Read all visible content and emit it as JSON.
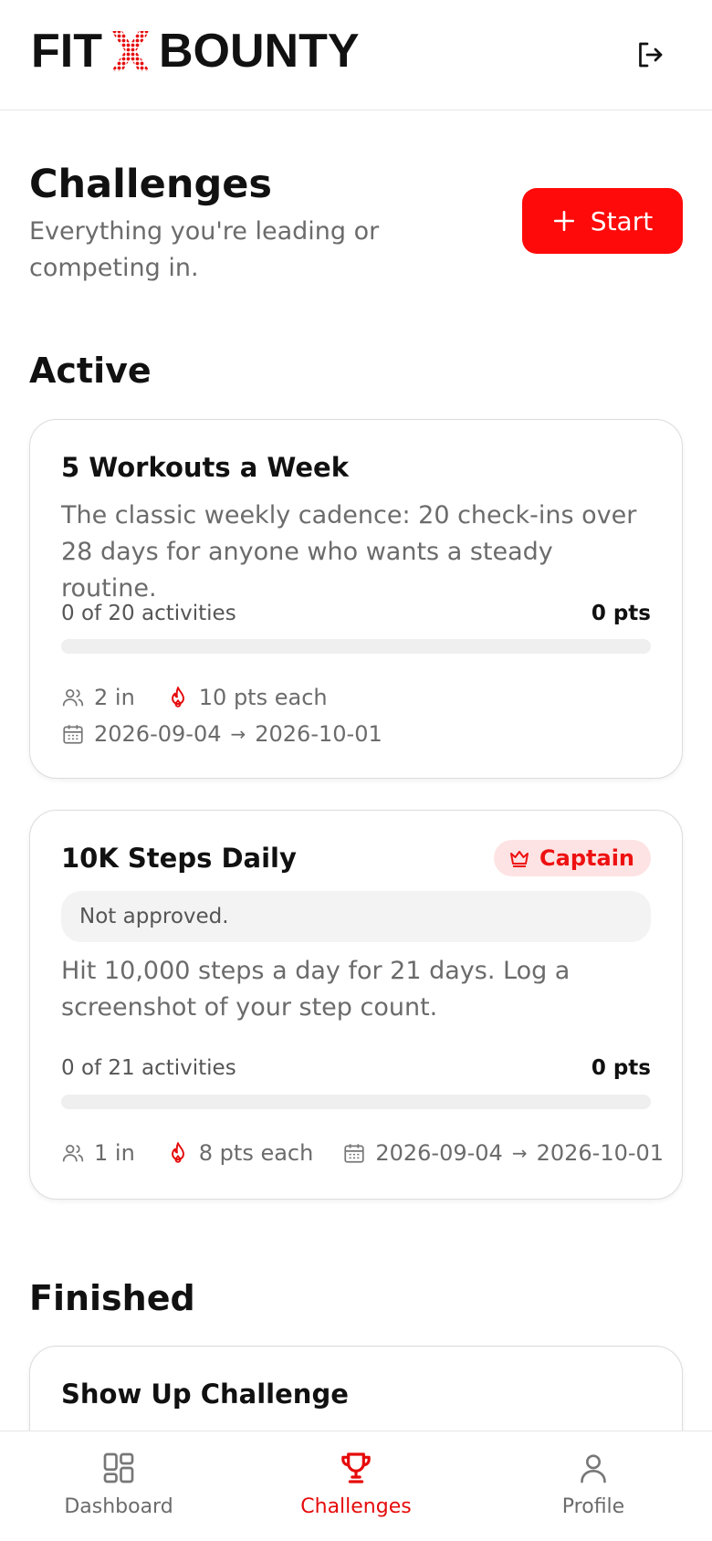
{
  "app": {
    "logo_left": "FIT",
    "logo_right": "BOUNTY"
  },
  "colors": {
    "accent": "#ff0a0a",
    "muted_text": "#6b6b6b",
    "badge_bg": "#fde3e3"
  },
  "header": {
    "logout_icon": "logout-icon"
  },
  "page": {
    "title": "Challenges",
    "subtitle": "Everything you're leading or competing in.",
    "start_label": "Start"
  },
  "sections": {
    "active_title": "Active",
    "finished_title": "Finished"
  },
  "active": [
    {
      "title": "5 Workouts a Week",
      "description": "The classic weekly cadence: 20 check-ins over 28 days for anyone who wants a steady routine.",
      "progress_label": "0 of 20 activities",
      "points": "0 pts",
      "progress": 0,
      "participants": "2 in",
      "pts_each": "10 pts each",
      "start_date": "2026-09-04",
      "arrow": "→",
      "end_date": "2026-10-01"
    },
    {
      "title": "10K Steps Daily",
      "badge": "Captain",
      "notice": "Not approved.",
      "description": "Hit 10,000 steps a day for 21 days. Log a screenshot of your step count.",
      "progress_label": "0 of 21 activities",
      "points": "0 pts",
      "progress": 0,
      "participants": "1 in",
      "pts_each": "8 pts each",
      "start_date": "2026-09-04",
      "arrow": "→",
      "end_date": "2026-10-01"
    }
  ],
  "finished": [
    {
      "title": "Show Up Challenge"
    }
  ],
  "nav": [
    {
      "label": "Dashboard",
      "icon": "dashboard-icon",
      "active": false
    },
    {
      "label": "Challenges",
      "icon": "trophy-icon",
      "active": true
    },
    {
      "label": "Profile",
      "icon": "user-icon",
      "active": false
    }
  ]
}
